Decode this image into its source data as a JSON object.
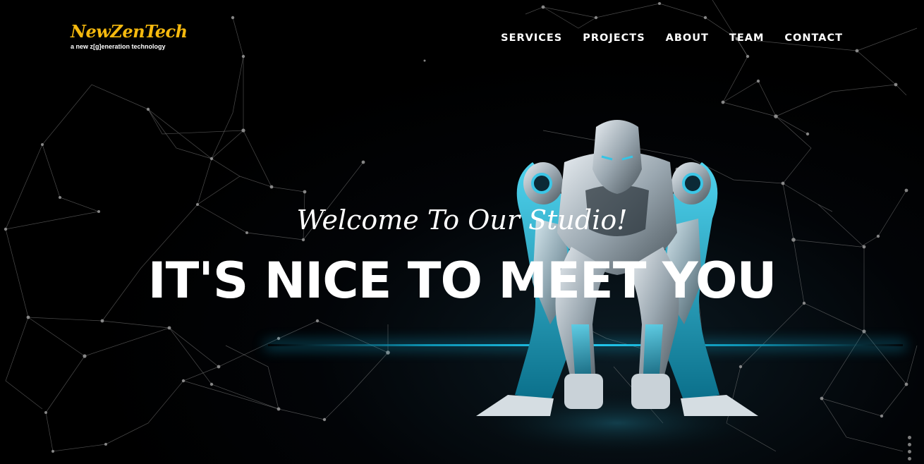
{
  "brand": {
    "name": "NewZenTech",
    "tagline": "a new z[g]eneration technology",
    "accent_color": "#f5b90e"
  },
  "nav": {
    "items": [
      {
        "label": "SERVICES"
      },
      {
        "label": "PROJECTS"
      },
      {
        "label": "ABOUT"
      },
      {
        "label": "TEAM"
      },
      {
        "label": "CONTACT"
      }
    ]
  },
  "hero": {
    "subtitle": "Welcome To Our Studio!",
    "headline": "IT'S NICE TO MEET YOU",
    "background_color": "#000000",
    "glow_color": "#23c9ef"
  },
  "scroll_indicator": {
    "icon": "scroll-dots-icon"
  }
}
